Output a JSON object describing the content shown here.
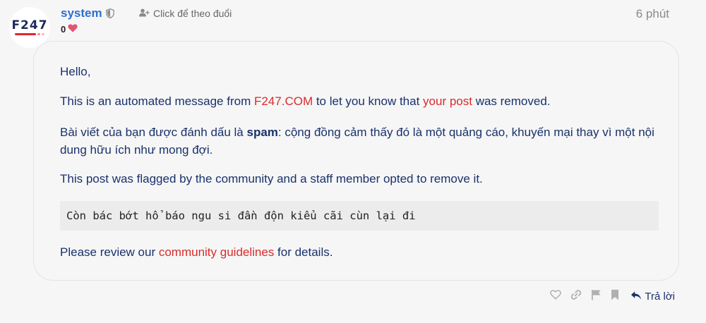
{
  "post": {
    "avatar_alt": "F247",
    "username": "system",
    "follow_label": "Click để theo đuổi",
    "like_count": "0",
    "time_ago": "6 phút"
  },
  "message": {
    "greeting": "Hello,",
    "intro_pre": "This is an automated message from ",
    "site_link": "F247.COM",
    "intro_mid": " to let you know that ",
    "post_link": "your post",
    "intro_post": " was removed.",
    "flag_pre": "Bài viết của bạn được đánh dấu là ",
    "flag_reason": "spam",
    "flag_post": ": cộng đồng cảm thấy đó là một quảng cáo, khuyến mại thay vì một nội dung hữu ích như mong đợi.",
    "staff_note": "This post was flagged by the community and a staff member opted to remove it.",
    "quoted_text": "Còn bác bớt hổ báo ngu si đần độn kiểu cãi cùn lại đi",
    "review_pre": "Please review our ",
    "guidelines_link": "community guidelines",
    "review_post": " for details."
  },
  "actions": {
    "reply_label": "Trả lời"
  },
  "colors": {
    "accent": "#2c6fd3",
    "link": "#d92b2b",
    "text": "#19316b",
    "heart": "#e45575"
  }
}
